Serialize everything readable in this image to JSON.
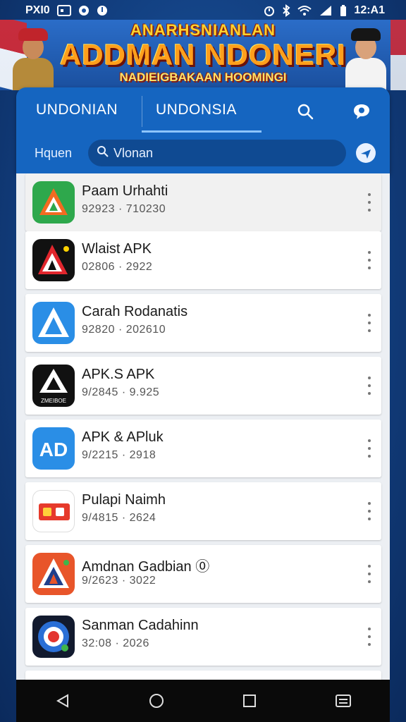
{
  "status_bar": {
    "left_text": "PXI0",
    "time": "12:A1"
  },
  "banner": {
    "title_top": "ANARHSNIANLAN",
    "title_main": "ADDMAN NDONERI",
    "subtitle": "NADIEIGBAKAAN HOOMINGI"
  },
  "header": {
    "tabs": [
      {
        "label": "UNDONIAN"
      },
      {
        "label": "UNDONSIA",
        "active": true
      }
    ],
    "filter_label": "Hquen",
    "search": {
      "value": "Vlonan"
    }
  },
  "apps": [
    {
      "name": "Paam Urhahti",
      "meta": "92923 · 710230",
      "icon": "triangle-logo-green"
    },
    {
      "name": "Wlaist APK",
      "meta": "02806 · 2922",
      "icon": "triangle-logo-black-red"
    },
    {
      "name": "Carah Rodanatis",
      "meta": "92820 · 202610",
      "icon": "triangle-logo-blue"
    },
    {
      "name": "APK.S APK",
      "meta": "9/2845 · 9.925",
      "icon": "triangle-logo-black-white",
      "icon_caption": "ZMEIBOE"
    },
    {
      "name": "APK & APluk",
      "meta": "9/2215 · 2918",
      "icon": "ad-logo-blue",
      "icon_text": "AD"
    },
    {
      "name": "Pulapi Naimh",
      "meta": "9/4815 · 2624",
      "icon": "red-card-logo"
    },
    {
      "name": "Amdnan Gadbian ⓪",
      "meta": "9/2623 · 3022",
      "icon": "triangle-logo-orange"
    },
    {
      "name": "Sanman Cadahinn",
      "meta": "32:08 · 2026",
      "icon": "circle-logo-blue"
    }
  ],
  "colors": {
    "header": "#1565c0",
    "accent": "#8ec5ff",
    "list_bg": "#eceff3"
  }
}
